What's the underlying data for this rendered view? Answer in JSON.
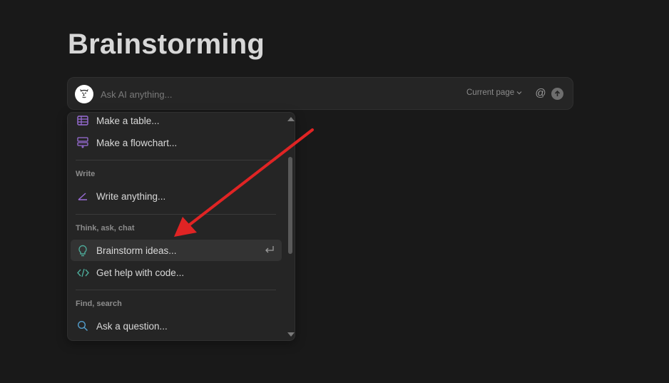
{
  "page": {
    "title": "Brainstorming"
  },
  "ai_bar": {
    "placeholder": "Ask AI anything...",
    "scope_label": "Current page",
    "mention_symbol": "@",
    "avatar_icon": "ai-face-icon",
    "send_icon": "arrow-up-icon"
  },
  "menu": {
    "items_top": [
      {
        "label": "Make a table...",
        "icon": "table-icon",
        "color": "#9a6dd7"
      },
      {
        "label": "Make a flowchart...",
        "icon": "flowchart-icon",
        "color": "#9a6dd7"
      }
    ],
    "sections": [
      {
        "title": "Write",
        "items": [
          {
            "label": "Write anything...",
            "icon": "pen-angle-icon",
            "color": "#9a6dd7"
          }
        ]
      },
      {
        "title": "Think, ask, chat",
        "items": [
          {
            "label": "Brainstorm ideas...",
            "icon": "lightbulb-icon",
            "color": "#4dab9a",
            "highlighted": true
          },
          {
            "label": "Get help with code...",
            "icon": "code-icon",
            "color": "#4dab9a"
          }
        ]
      },
      {
        "title": "Find, search",
        "items": [
          {
            "label": "Ask a question...",
            "icon": "search-icon",
            "color": "#529cca"
          }
        ]
      }
    ]
  },
  "annotation": {
    "arrow_color": "#e02424"
  }
}
